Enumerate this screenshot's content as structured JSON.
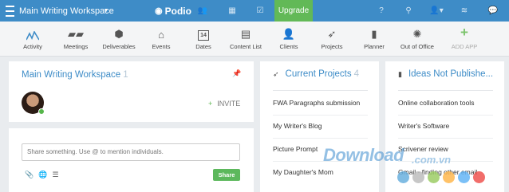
{
  "topbar": {
    "workspace_name": "Main Writing Workspace",
    "logo_text": "Podio",
    "upgrade_label": "Upgrade"
  },
  "apps": [
    {
      "label": "Activity",
      "icon": "activity-icon"
    },
    {
      "label": "Meetings",
      "icon": "meetings-icon"
    },
    {
      "label": "Deliverables",
      "icon": "deliverables-icon"
    },
    {
      "label": "Events",
      "icon": "events-icon"
    },
    {
      "label": "Dates",
      "icon": "calendar-icon",
      "icon_text": "14"
    },
    {
      "label": "Content List",
      "icon": "content-list-icon"
    },
    {
      "label": "Clients",
      "icon": "clients-icon"
    },
    {
      "label": "Projects",
      "icon": "rocket-icon"
    },
    {
      "label": "Planner",
      "icon": "planner-icon"
    },
    {
      "label": "Out of Office",
      "icon": "sun-icon"
    },
    {
      "label": "ADD APP",
      "icon": "plus-icon"
    }
  ],
  "workspace_card": {
    "title": "Main Writing Workspace",
    "count": "1",
    "invite_label": "INVITE"
  },
  "share": {
    "placeholder": "Share something. Use @ to mention individuals.",
    "button_label": "Share"
  },
  "projects": {
    "title": "Current Projects",
    "count": "4",
    "items": [
      "FWA Paragraphs submission",
      "My Writer's Blog",
      "Picture Prompt",
      "My Daughter's Mom"
    ]
  },
  "ideas": {
    "title": "Ideas Not Publishe...",
    "items": [
      "Online collaboration tools",
      "Writer's Software",
      "Scrivener review",
      "Gmail - finding other email"
    ]
  },
  "watermark": {
    "text": "Download",
    "domain": ".com.vn",
    "dot_colors": [
      "#6ab0de",
      "#bdbdbd",
      "#9ccc65",
      "#ffb74d",
      "#64b5f6",
      "#ef5350"
    ]
  },
  "colors": {
    "topbar": "#3e8cc7",
    "upgrade": "#62b957",
    "accent": "#3e8cc7"
  }
}
